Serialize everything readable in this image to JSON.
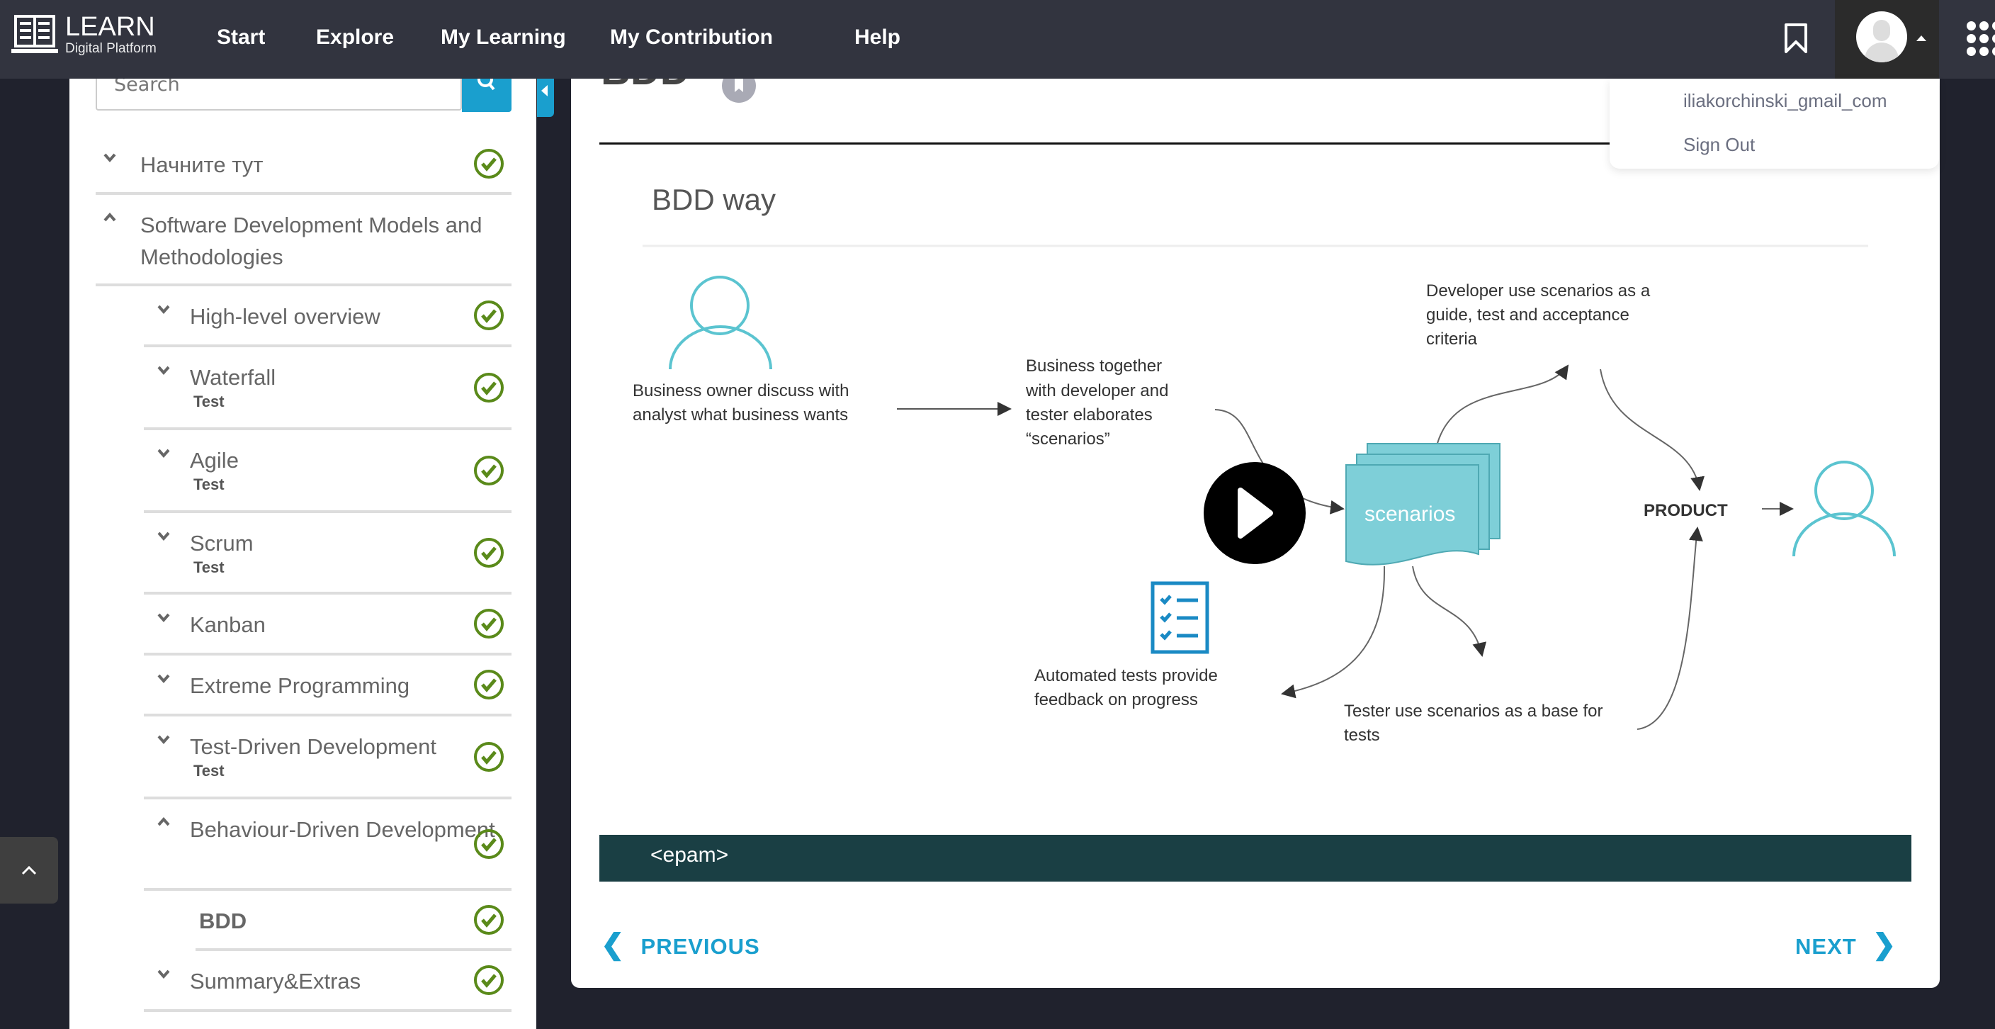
{
  "nav": {
    "logo_title": "LEARN",
    "logo_subtitle": "Digital Platform",
    "items": [
      "Start",
      "Explore",
      "My Learning",
      "My Contribution",
      "Help"
    ]
  },
  "user_menu": {
    "username": "iliakorchinski_gmail_com",
    "sign_out": "Sign Out"
  },
  "sidebar": {
    "search_placeholder": "Search",
    "items": [
      {
        "label": "Начните тут",
        "sub": "",
        "expanded": false,
        "done": true
      },
      {
        "label": "Software Development Models and Methodologies",
        "sub": "",
        "expanded": true,
        "done": false
      },
      {
        "label": "High-level overview",
        "sub": "",
        "done": true
      },
      {
        "label": "Waterfall",
        "sub": "Test",
        "done": true
      },
      {
        "label": "Agile",
        "sub": "Test",
        "done": true
      },
      {
        "label": "Scrum",
        "sub": "Test",
        "done": true
      },
      {
        "label": "Kanban",
        "sub": "",
        "done": true
      },
      {
        "label": "Extreme Programming",
        "sub": "",
        "done": true
      },
      {
        "label": "Test-Driven Development",
        "sub": "Test",
        "done": true
      },
      {
        "label": "Behaviour-Driven Development",
        "sub": "",
        "expanded": true,
        "done": true
      },
      {
        "label": "BDD",
        "sub": "",
        "current": true,
        "done": true
      },
      {
        "label": "Summary&Extras",
        "sub": "",
        "done": true
      }
    ]
  },
  "main": {
    "title": "BDD",
    "previous": "PREVIOUS",
    "next": "NEXT",
    "video": {
      "slide_title": "BDD way",
      "owner_text": [
        "Business owner discuss with",
        "analyst what business wants"
      ],
      "together_text": [
        "Business together",
        "with developer and",
        "tester elaborates",
        "“scenarios”"
      ],
      "developer_text": [
        "Developer use scenarios as a",
        "guide, test and acceptance",
        "criteria"
      ],
      "automated_text": [
        "Automated tests provide",
        "feedback on progress"
      ],
      "tester_text": [
        "Tester use scenarios as a base for",
        "tests"
      ],
      "scenarios": "scenarios",
      "product": "PRODUCT",
      "brand": "<epam>"
    }
  },
  "colors": {
    "nav": "#32343f",
    "accent": "#1a9fce",
    "check": "#5a8a1a",
    "scenario": "#7ecfd8"
  }
}
